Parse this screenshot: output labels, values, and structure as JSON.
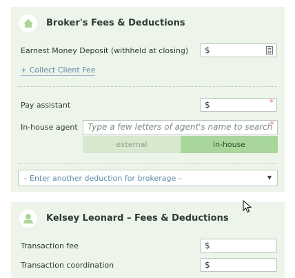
{
  "broker_section": {
    "title": "Broker's Fees & Deductions",
    "earnest_money_label": "Earnest Money Deposit (withheld at closing)",
    "earnest_money_value": "$",
    "collect_fee_link": "+ Collect Client Fee",
    "pay_assistant_label": "Pay assistant",
    "pay_assistant_value": "$",
    "required_marker": "*",
    "inhouse_agent_label": "In-house agent",
    "inhouse_agent_placeholder": "Type a few letters of agent's name to search",
    "toggle_external": "external",
    "toggle_inhouse": "in-house",
    "selected_toggle": "in-house",
    "deduction_select": "– Enter another deduction for brokerage –"
  },
  "agent_section": {
    "title": "Kelsey Leonard – Fees & Deductions",
    "transaction_fee_label": "Transaction fee",
    "transaction_fee_value": "$",
    "coordination_label": "Transaction coordination",
    "coordination_value": "$"
  },
  "colors": {
    "panel_bg": "#edf4e9",
    "accent_green": "#a9d79b",
    "link_blue": "#5b8aa8",
    "required_red": "#e07f6c"
  }
}
